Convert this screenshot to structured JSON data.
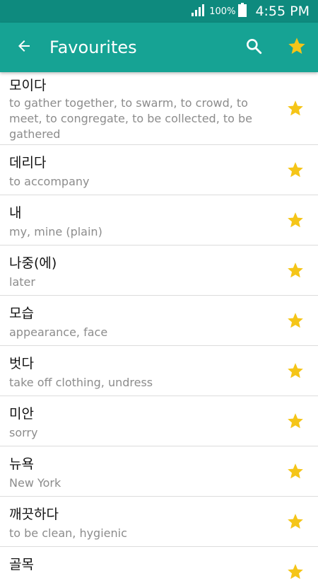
{
  "status_bar": {
    "battery_text": "100%",
    "time": "4:55 PM"
  },
  "app_bar": {
    "title": "Favourites",
    "back_icon": "arrow-left-icon",
    "search_icon": "search-icon",
    "favourite_icon": "star-icon"
  },
  "colors": {
    "status_bar": "#0e8a7e",
    "app_bar": "#16a394",
    "star": "#f5c518",
    "word": "#111111",
    "meaning": "#8c8c8c"
  },
  "favourites": [
    {
      "word": "모이다",
      "meaning": "to gather together, to swarm, to crowd, to meet, to congregate, to be collected, to be gathered"
    },
    {
      "word": "데리다",
      "meaning": "to accompany"
    },
    {
      "word": "내",
      "meaning": "my, mine (plain)"
    },
    {
      "word": "나중(에)",
      "meaning": "later"
    },
    {
      "word": "모습",
      "meaning": "appearance, face"
    },
    {
      "word": "벗다",
      "meaning": "take off clothing, undress"
    },
    {
      "word": "미안",
      "meaning": "sorry"
    },
    {
      "word": "뉴욕",
      "meaning": "New York"
    },
    {
      "word": "깨끗하다",
      "meaning": "to be clean, hygienic"
    },
    {
      "word": "골목",
      "meaning": ""
    }
  ]
}
